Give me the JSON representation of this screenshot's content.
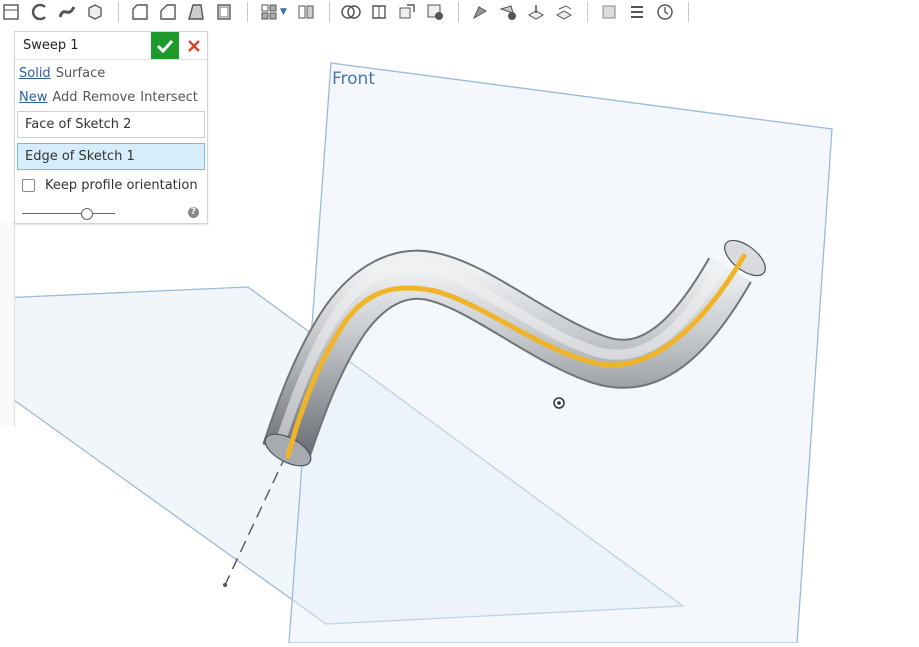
{
  "toolbar": {
    "groups": [
      [
        "new-sketch-icon",
        "fillet-icon",
        "curve-icon",
        "import-icon"
      ],
      [
        "chamfer-icon",
        "draft-icon",
        "loft-icon",
        "shell-icon"
      ],
      [
        "pattern-icon",
        "mirror-icon"
      ],
      [
        "boolean-icon",
        "split-icon",
        "transform-icon",
        "delete-part-icon"
      ],
      [
        "modify-face-icon",
        "delete-face-icon",
        "move-face-icon",
        "replace-face-icon"
      ],
      [
        "plane-icon",
        "helix-icon",
        "history-icon"
      ]
    ]
  },
  "dialog": {
    "title": "Sweep 1",
    "body_type": {
      "options": [
        "Solid",
        "Surface"
      ],
      "selected": "Solid"
    },
    "operation": {
      "options": [
        "New",
        "Add",
        "Remove",
        "Intersect"
      ],
      "selected": "New"
    },
    "profile_field": "Face of Sketch 2",
    "path_field": "Edge of Sketch 1",
    "keep_orientation_label": "Keep profile orientation",
    "keep_orientation_checked": false,
    "slider_value": 0.7
  },
  "viewport": {
    "plane_label": "Front",
    "colors": {
      "plane_fill": "#e7f0f8",
      "plane_edge": "#9bbad8",
      "path": "#f0b429",
      "solid": "#b9bcc0"
    }
  }
}
